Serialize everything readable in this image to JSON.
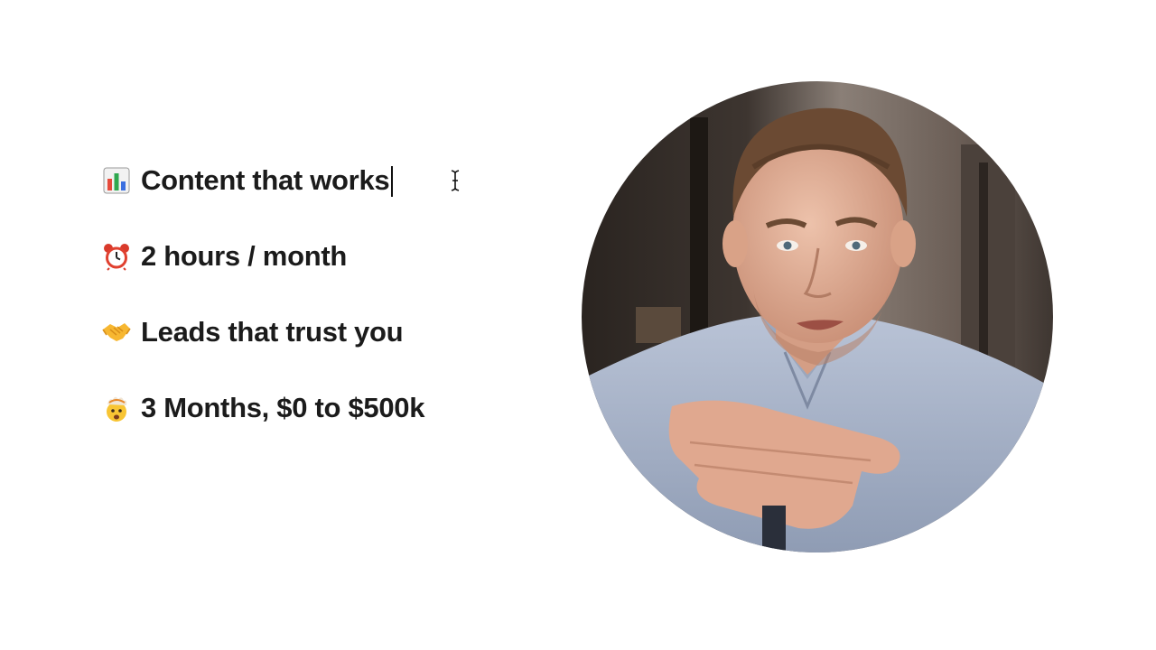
{
  "editor": {
    "lines": [
      {
        "icon": "bar-chart-icon",
        "text": "Content that works"
      },
      {
        "icon": "alarm-clock-icon",
        "text": "2 hours / month"
      },
      {
        "icon": "handshake-icon",
        "text": "Leads that trust you"
      },
      {
        "icon": "exploding-head-icon",
        "text": "3 Months, $0 to $500k"
      }
    ]
  },
  "cursor": {
    "icon": "text-cursor-ibeam-icon"
  },
  "avatar": {
    "icon": "presenter-video-circle"
  },
  "colors": {
    "background": "#ffffff",
    "text": "#1b1b1b",
    "shirt": "#a9b4c8",
    "skin": "#e2b29c",
    "hair": "#6b4a33"
  }
}
